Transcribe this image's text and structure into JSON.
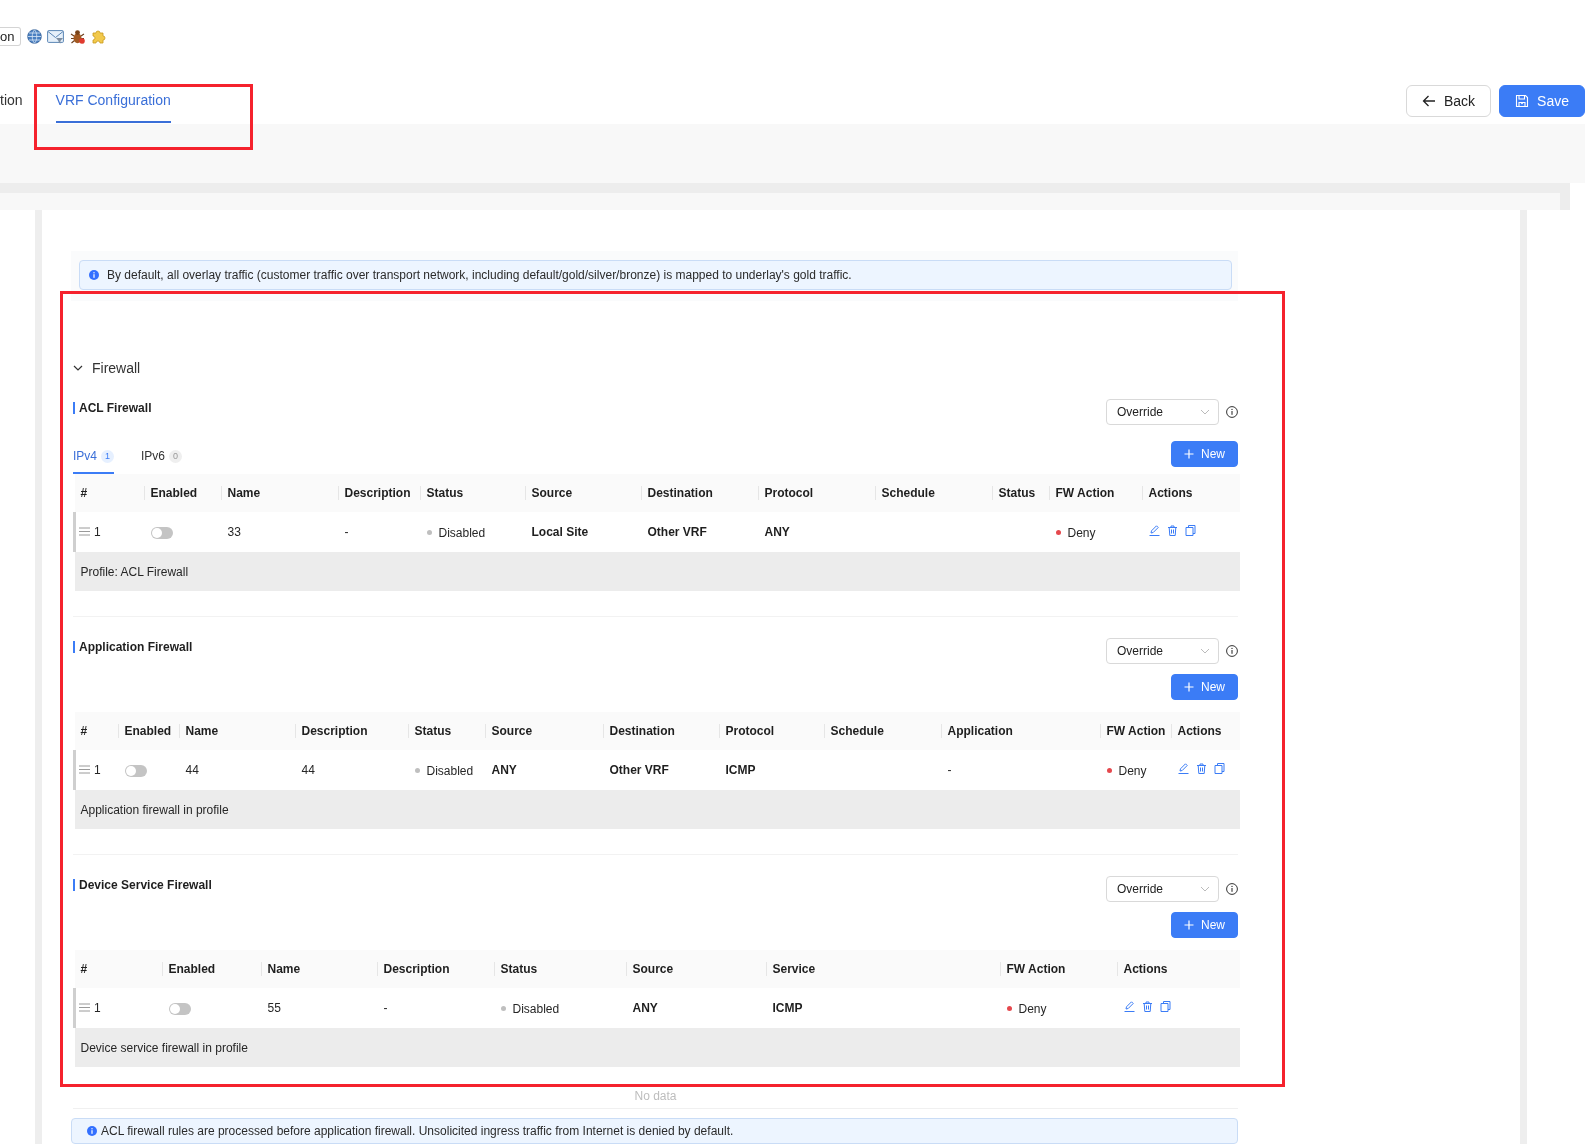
{
  "toolbar": {
    "button": "on"
  },
  "tabs": [
    {
      "label": "tion",
      "selected": false,
      "highlighted": false
    },
    {
      "label": "VRF Configuration",
      "selected": true,
      "highlighted": true
    }
  ],
  "buttons": [
    {
      "kind": "back",
      "label": "Back"
    },
    {
      "kind": "save",
      "label": "Save"
    }
  ],
  "notice": {
    "text": "By default, all overlay traffic (customer traffic over transport network, including default/gold/silver/bronze) is mapped to underlay's gold traffic."
  },
  "firewall": {
    "title": "Firewall",
    "expanded": true,
    "highlighted": true,
    "sections": [
      {
        "title": "ACL Firewall",
        "mode": "Override",
        "tabs": [
          {
            "label": "IPv4",
            "count": "1",
            "selected": true
          },
          {
            "label": "IPv6",
            "count": "0",
            "selected": false
          }
        ],
        "new_button": "New",
        "table": {
          "columns": [
            "#",
            "Enabled",
            "Name",
            "Description",
            "Status",
            "Source",
            "Destination",
            "Protocol",
            "Schedule",
            "Status",
            "FW Action",
            "Actions"
          ],
          "rows": [
            {
              "cells": [
                {
                  "kind": "index",
                  "text": "1"
                },
                {
                  "kind": "toggle",
                  "on": false
                },
                {
                  "kind": "text",
                  "text": "33"
                },
                {
                  "kind": "text",
                  "text": "-"
                },
                {
                  "kind": "status",
                  "text": "Disabled",
                  "color": "#bfbfbf"
                },
                {
                  "kind": "strong",
                  "text": "Local Site"
                },
                {
                  "kind": "strong",
                  "text": "Other VRF"
                },
                {
                  "kind": "strong",
                  "text": "ANY"
                },
                {
                  "kind": "blank"
                },
                {
                  "kind": "blank"
                },
                {
                  "kind": "status",
                  "text": "Deny",
                  "color": "#e5484d"
                },
                {
                  "kind": "actions"
                }
              ]
            }
          ],
          "note": "Profile: ACL Firewall"
        }
      },
      {
        "title": "Application Firewall",
        "mode": "Override",
        "new_button": "New",
        "table": {
          "columns": [
            "#",
            "Enabled",
            "Name",
            "Description",
            "Status",
            "Source",
            "Destination",
            "Protocol",
            "Schedule",
            "Application",
            "FW Action",
            "Actions"
          ],
          "rows": [
            {
              "cells": [
                {
                  "kind": "index",
                  "text": "1"
                },
                {
                  "kind": "toggle",
                  "on": false
                },
                {
                  "kind": "text",
                  "text": "44"
                },
                {
                  "kind": "text",
                  "text": "44"
                },
                {
                  "kind": "status",
                  "text": "Disabled",
                  "color": "#bfbfbf"
                },
                {
                  "kind": "strong",
                  "text": "ANY"
                },
                {
                  "kind": "strong",
                  "text": "Other VRF"
                },
                {
                  "kind": "strong",
                  "text": "ICMP"
                },
                {
                  "kind": "blank"
                },
                {
                  "kind": "text",
                  "text": "-"
                },
                {
                  "kind": "status",
                  "text": "Deny",
                  "color": "#e5484d"
                },
                {
                  "kind": "actions"
                }
              ]
            }
          ],
          "note": "Application firewall in profile"
        }
      },
      {
        "title": "Device Service Firewall",
        "mode": "Override",
        "new_button": "New",
        "table": {
          "columns": [
            "#",
            "Enabled",
            "Name",
            "Description",
            "Status",
            "Source",
            "Service",
            "FW Action",
            "Actions"
          ],
          "rows": [
            {
              "cells": [
                {
                  "kind": "index",
                  "text": "1"
                },
                {
                  "kind": "toggle",
                  "on": false
                },
                {
                  "kind": "text",
                  "text": "55"
                },
                {
                  "kind": "text",
                  "text": "-"
                },
                {
                  "kind": "status",
                  "text": "Disabled",
                  "color": "#bfbfbf"
                },
                {
                  "kind": "strong",
                  "text": "ANY"
                },
                {
                  "kind": "strong",
                  "text": "ICMP"
                },
                {
                  "kind": "status",
                  "text": "Deny",
                  "color": "#e5484d"
                },
                {
                  "kind": "actions"
                }
              ]
            }
          ],
          "note": "Device service firewall in profile"
        }
      }
    ]
  },
  "empty_text": "No data",
  "footer_notice": {
    "text": "ACL firewall rules are processed before application firewall. Unsolicited ingress traffic from Internet is denied by default."
  }
}
